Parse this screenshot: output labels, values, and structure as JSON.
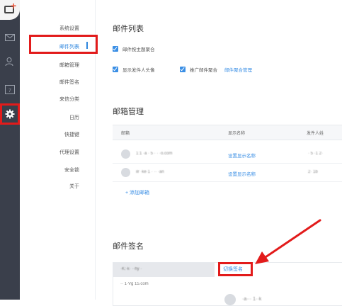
{
  "sidebar": {
    "icons": [
      "compose-icon",
      "mail-icon",
      "contacts-icon",
      "calendar-icon",
      "gear-icon"
    ]
  },
  "menu": {
    "items": [
      {
        "label": "系统设置"
      },
      {
        "label": "邮件列表"
      },
      {
        "label": "邮箱管理"
      },
      {
        "label": "邮件签名"
      },
      {
        "label": "来信分类"
      },
      {
        "label": "日历"
      },
      {
        "label": "快捷键"
      },
      {
        "label": "代理设置"
      },
      {
        "label": "安全锁"
      },
      {
        "label": "关于"
      }
    ]
  },
  "mail_list": {
    "title": "邮件列表",
    "opt_group_by_topic": "邮件按主题聚合",
    "opt_show_avatar": "显示发件人头像",
    "opt_promo_aggregate": "推广邮件聚合",
    "link_aggregate_manage": "邮件聚合管理"
  },
  "mailbox_mgmt": {
    "title": "邮箱管理",
    "columns": [
      "邮箱",
      "显示名称",
      "发件人姓"
    ],
    "rows": [
      {
        "email": "1:1 ·a · 5 · · ·o.com",
        "display_link": "设置显示名称",
        "sender": "· 5 ·1 2·"
      },
      {
        "email": "ilr ·ke·1 · ·· ·an",
        "display_link": "设置显示名称",
        "sender": "2· 1b"
      }
    ],
    "add_label": "+  添加邮箱"
  },
  "signature": {
    "title": "邮件签名",
    "account_1": "·K:·k· ··hy ·",
    "account_2": "·· 1·Vg 15.com",
    "switch_label": "切换签名",
    "preview_name": "·a··· 1··k"
  },
  "colors": {
    "accent": "#3b8fe5",
    "highlight": "#e21b1b",
    "sidebar_bg": "#3a3f4b"
  }
}
